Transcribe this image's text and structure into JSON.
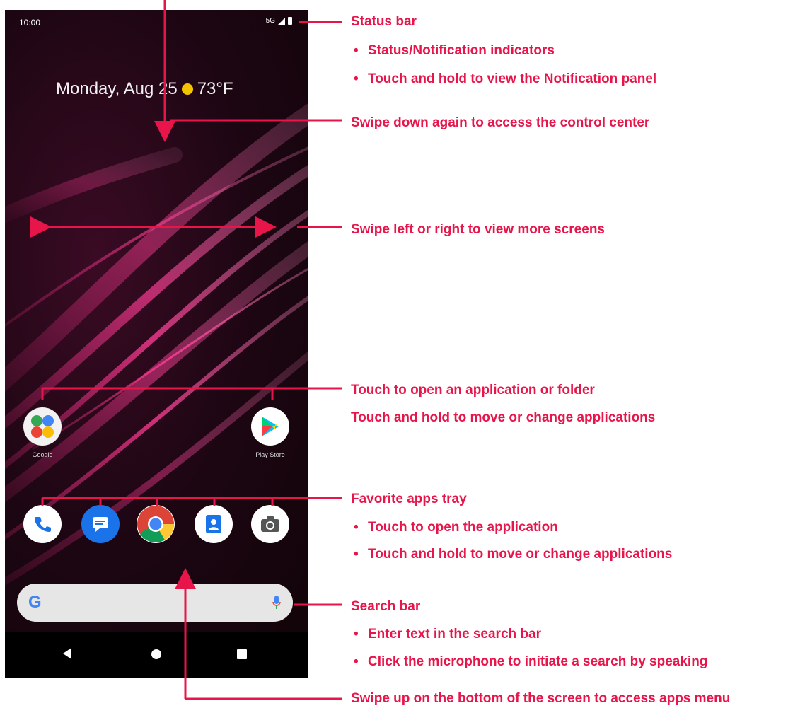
{
  "status_bar": {
    "time": "10:00",
    "network": "5G"
  },
  "home": {
    "date": "Monday, Aug 25",
    "temperature": "73°F",
    "weather_icon": "sun-icon"
  },
  "apps": {
    "google_folder_label": "Google",
    "play_store_label": "Play Store"
  },
  "favorites": [
    "phone-icon",
    "messages-icon",
    "chrome-icon",
    "contacts-icon",
    "camera-icon"
  ],
  "search_bar": {
    "logo": "G",
    "mic_icon": "microphone-icon"
  },
  "nav_bar": [
    "back-icon",
    "home-icon",
    "recents-icon"
  ],
  "annotations": {
    "status_bar_title": "Status bar",
    "status_bar_bullet_1": "Status/Notification indicators",
    "status_bar_bullet_2": "Touch and hold to view the Notification panel",
    "swipe_down": "Swipe down again to access the control center",
    "swipe_lr": "Swipe left or right to view more screens",
    "open_app": "Touch to open an application or folder",
    "move_app": "Touch and hold to move or change applications",
    "favorites_title": "Favorite apps tray",
    "favorites_bullet_1": "Touch to open the application",
    "favorites_bullet_2": "Touch and hold to move or change applications",
    "search_title": "Search bar",
    "search_bullet_1": "Enter text in the search bar",
    "search_bullet_2": "Click the microphone to initiate a search by speaking",
    "swipe_up": "Swipe up on the bottom of the screen to access apps menu"
  },
  "colors": {
    "accent": "#e8154a",
    "wallpaper": "#1c0612"
  }
}
